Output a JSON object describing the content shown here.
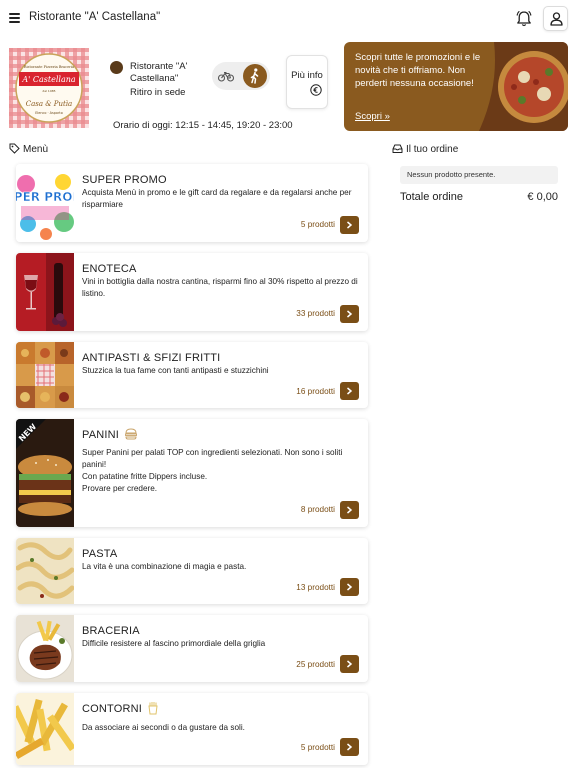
{
  "header": {
    "title": "Ristorante \"A' Castellana\"",
    "menu_icon": "hamburger-icon",
    "notify_icon": "bell-icon",
    "account_icon": "user-icon"
  },
  "restaurant": {
    "logo_text": {
      "top": "Ristorante Pizzeria Braceria",
      "name": "A' Castellana",
      "est": "dal 1985",
      "tagline": "Casa & Putìa",
      "sub": "Elenco · Asporto"
    },
    "name": "Ristorante \"A' Castellana\"",
    "mode": "Ritiro in sede",
    "more_info_label": "Più info",
    "hours": "Orario di oggi: 12:15 - 14:45, 19:20 - 23:00",
    "toggle_options": [
      "bike-icon",
      "walking-icon"
    ]
  },
  "promo": {
    "text": "Scopri tutte le promozioni e le novità che ti offriamo. Non perderti nessuna occasione!",
    "link": "Scopri »"
  },
  "menu": {
    "heading": "Menù",
    "categories": [
      {
        "title": "SUPER PROMO",
        "desc": "Acquista Menù in promo e le gift card da regalare e da regalarsi anche per risparmiare",
        "count": "5 prodotti",
        "thumb_text": "SUPER PROMO"
      },
      {
        "title": "ENOTECA",
        "desc": "Vini in bottiglia dalla nostra cantina, risparmi fino al 30% rispetto al prezzo di listino.",
        "count": "33 prodotti"
      },
      {
        "title": "ANTIPASTI & SFIZI FRITTI",
        "desc": "Stuzzica la tua fame con tanti antipasti e stuzzichini",
        "count": "16 prodotti"
      },
      {
        "title": "PANINI",
        "desc": "Super Panini per palati TOP con ingredienti selezionati. Non sono i soliti panini!\nCon patatine fritte Dippers incluse.\nProvare per credere.",
        "count": "8 prodotti",
        "thumb_text": "NEW"
      },
      {
        "title": "PASTA",
        "desc": "La vita è una combinazione di magia e pasta.",
        "count": "13 prodotti"
      },
      {
        "title": "BRACERIA",
        "desc": "Difficile resistere al fascino primordiale della griglia",
        "count": "25 prodotti"
      },
      {
        "title": "CONTORNI",
        "desc": "Da associare ai secondi o da gustare da soli.",
        "count": "5 prodotti"
      }
    ]
  },
  "order": {
    "heading": "Il tuo ordine",
    "empty": "Nessun prodotto presente.",
    "total_label": "Totale ordine",
    "total_value": "€ 0,00"
  },
  "colors": {
    "brand": "#7a4e16",
    "accent": "#8a5a1f",
    "logo_red": "#d9232e"
  }
}
